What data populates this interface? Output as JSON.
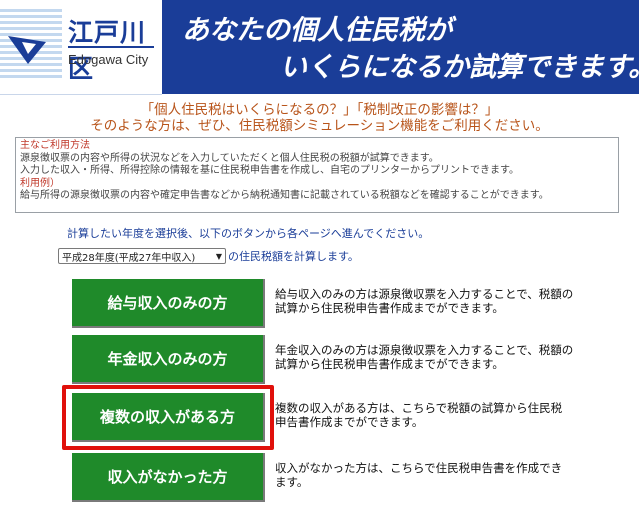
{
  "header": {
    "logo_jp": "江戸川区",
    "logo_en": "Edogawa City",
    "tagline_line1": "あなたの個人住民税が",
    "tagline_line2": "いくらになるか試算できます。"
  },
  "intro": {
    "line1": "「個人住民税はいくらになるの？」「税制改正の影響は？」",
    "line2": "そのような方は、ぜひ、住民税額シミュレーション機能をご利用ください。"
  },
  "info": {
    "heading_usage": "主なご利用方法",
    "usage_line1": "源泉徴収票の内容や所得の状況などを入力していただくと個人住民税の税額が試算できます。",
    "usage_line2": "入力した収入・所得、所得控除の情報を基に住民税申告書を作成し、自宅のプリンターからプリントできます。",
    "heading_example": "利用例）",
    "example_line1": "給与所得の源泉徴収票の内容や確定申告書などから納税通知書に記載されている税額などを確認することができます。"
  },
  "instructions": {
    "text": "計算したい年度を選択後、以下のボタンから各ページへ進んでください。",
    "select_value": "平成28年度(平成27年中収入)",
    "select_suffix": "の住民税額を計算します。"
  },
  "actions": [
    {
      "label": "給与収入のみの方",
      "desc": "給与収入のみの方は源泉徴収票を入力することで、税額の試算から住民税申告書作成までができます。"
    },
    {
      "label": "年金収入のみの方",
      "desc": "年金収入のみの方は源泉徴収票を入力することで、税額の試算から住民税申告書作成までができます。"
    },
    {
      "label": "複数の収入がある方",
      "desc": "複数の収入がある方は、こちらで税額の試算から住民税申告書作成までができます。"
    },
    {
      "label": "収入がなかった方",
      "desc": "収入がなかった方は、こちらで住民税申告書を作成できます。"
    }
  ],
  "colors": {
    "header_blue": "#1a3d98",
    "button_green": "#1f8a2a",
    "highlight_red": "#e0100b",
    "intro_orange": "#b8541a"
  }
}
